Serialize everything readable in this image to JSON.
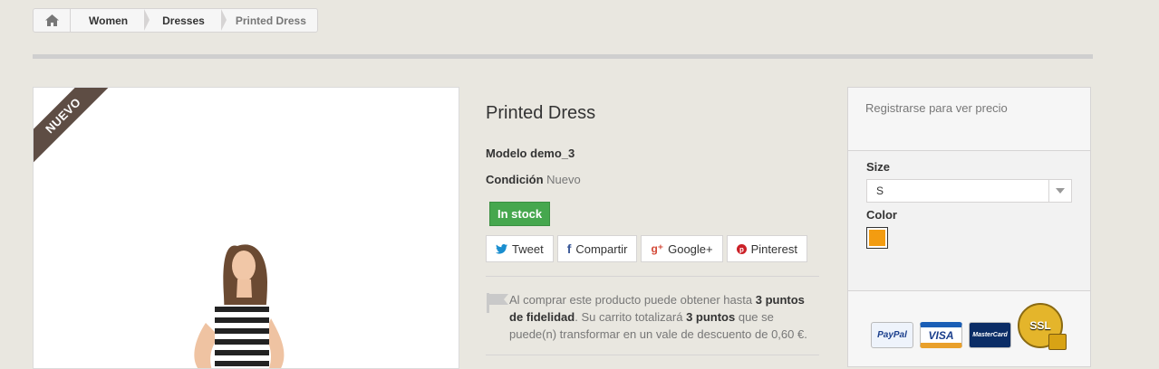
{
  "breadcrumb": {
    "home_icon": "home-icon",
    "items": [
      "Women",
      "Dresses"
    ],
    "current": "Printed Dress"
  },
  "product": {
    "badge": "NUEVO",
    "title": "Printed Dress",
    "model_label": "Modelo",
    "model_value": "demo_3",
    "condition_label": "Condición",
    "condition_value": "Nuevo",
    "stock": "In stock",
    "colors": {
      "stock_bg": "#46a74e",
      "badge_bg": "#5e4d44",
      "swatch": "#f39c11"
    }
  },
  "share": {
    "tweet": "Tweet",
    "facebook": "Compartir",
    "google": "Google+",
    "pinterest": "Pinterest"
  },
  "loyalty": {
    "text_1": "Al comprar este producto puede obtener hasta ",
    "points_1": "3 puntos de fidelidad",
    "text_2": ". Su carrito totalizará ",
    "points_2": "3 puntos",
    "text_3": " que se puede(n) transformar en un vale de descuento de 0,60 €."
  },
  "sidebar": {
    "price_text": "Registrarse para ver precio",
    "size_label": "Size",
    "size_value": "S",
    "color_label": "Color",
    "payments": {
      "paypal": "PayPal",
      "visa": "VISA",
      "mastercard": "MasterCard",
      "ssl": "SSL"
    }
  }
}
